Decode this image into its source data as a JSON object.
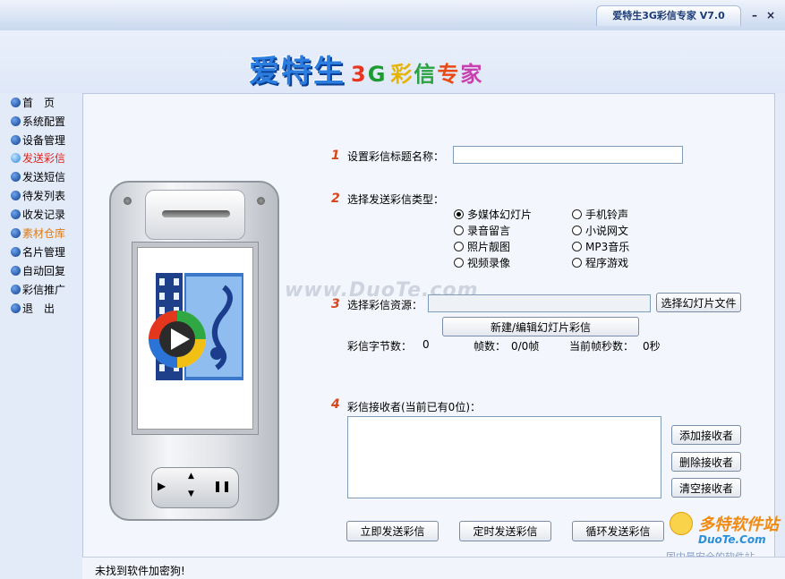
{
  "window": {
    "title": "爱特生3G彩信专家 V7.0",
    "minimize_glyph": "–",
    "close_glyph": "×"
  },
  "banner": {
    "brand": "爱特生",
    "sub_3": "3",
    "sub_G": "G",
    "sub_c1": "彩",
    "sub_c2": "信",
    "sub_c3": "专",
    "sub_c4": "家"
  },
  "sidebar": {
    "items": [
      {
        "label": "首　页"
      },
      {
        "label": "系统配置"
      },
      {
        "label": "设备管理"
      },
      {
        "label": "发送彩信"
      },
      {
        "label": "发送短信"
      },
      {
        "label": "待发列表"
      },
      {
        "label": "收发记录"
      },
      {
        "label": "素材仓库"
      },
      {
        "label": "名片管理"
      },
      {
        "label": "自动回复"
      },
      {
        "label": "彩信推广"
      },
      {
        "label": "退　出"
      }
    ]
  },
  "form": {
    "step1": {
      "num": "1",
      "label": "设置彩信标题名称：",
      "value": ""
    },
    "step2": {
      "num": "2",
      "label": "选择发送彩信类型：",
      "options": [
        {
          "label": "多媒体幻灯片"
        },
        {
          "label": "手机铃声"
        },
        {
          "label": "录音留言"
        },
        {
          "label": "小说网文"
        },
        {
          "label": "照片靓图"
        },
        {
          "label": "MP3音乐"
        },
        {
          "label": "视频录像"
        },
        {
          "label": "程序游戏"
        }
      ],
      "selected": "多媒体幻灯片"
    },
    "step3": {
      "num": "3",
      "label": "选择彩信资源：",
      "value": "",
      "select_button": "选择幻灯片文件",
      "edit_button": "新建/编辑幻灯片彩信",
      "bytes_label": "彩信字节数：",
      "bytes_value": "0",
      "frames_label": "帧数：",
      "frames_value": "0/0帧",
      "seconds_label": "当前帧秒数：",
      "seconds_value": "0秒"
    },
    "step4": {
      "num": "4",
      "label": "彩信接收者(当前已有0位)：",
      "add_button": "添加接收者",
      "delete_button": "删除接收者",
      "clear_button": "清空接收者"
    },
    "actions": {
      "send_now": "立即发送彩信",
      "send_timed": "定时发送彩信",
      "send_loop": "循环发送彩信"
    }
  },
  "phone": {
    "prev_glyph": "▶",
    "pause_glyph": "❚❚",
    "up_glyph": "▲",
    "down_glyph": "▼"
  },
  "watermarks": {
    "center": "www.DuoTe.com",
    "corner_title": "多特软件站",
    "corner_url": "DuoTe.Com",
    "corner_slogan": "国内最安全的软件站"
  },
  "status": {
    "text": "未找到软件加密狗!"
  }
}
